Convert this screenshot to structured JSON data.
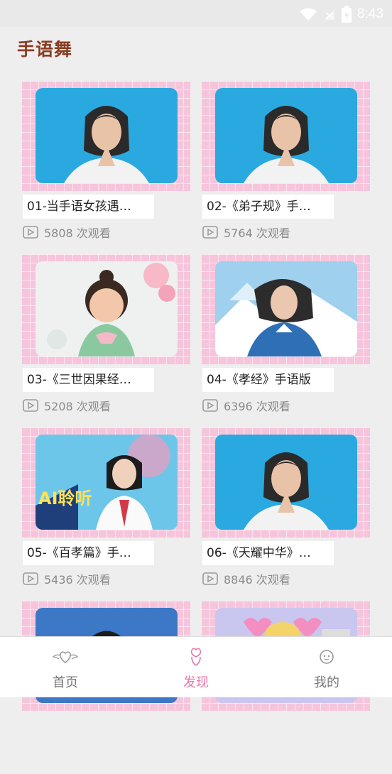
{
  "status_bar": {
    "time": "8:43"
  },
  "page": {
    "title": "手语舞"
  },
  "videos": [
    {
      "title": "01-当手语女孩遇…",
      "views": "5808 次观看",
      "thumb": "avatar-blue"
    },
    {
      "title": "02-《弟子规》手…",
      "views": "5764 次观看",
      "thumb": "avatar-blue"
    },
    {
      "title": "03-《三世因果经…",
      "views": "5208 次观看",
      "thumb": "cartoon-girl"
    },
    {
      "title": "04-《孝经》手语版",
      "views": "6396 次观看",
      "thumb": "snow-avatar"
    },
    {
      "title": "05-《百孝篇》手…",
      "views": "5436 次观看",
      "thumb": "ai-poster",
      "thumb_text": "AI聆听"
    },
    {
      "title": "06-《天耀中华》…",
      "views": "8846 次观看",
      "thumb": "avatar-blue"
    },
    {
      "title": "",
      "views": "",
      "thumb": "partial-blue"
    },
    {
      "title": "",
      "views": "",
      "thumb": "partial-hearts"
    }
  ],
  "bottom_nav": {
    "items": [
      {
        "label": "首页",
        "icon": "wings-heart-icon"
      },
      {
        "label": "发现",
        "icon": "hand-heart-icon"
      },
      {
        "label": "我的",
        "icon": "smiley-icon"
      }
    ],
    "active_color": "#e879a8"
  }
}
